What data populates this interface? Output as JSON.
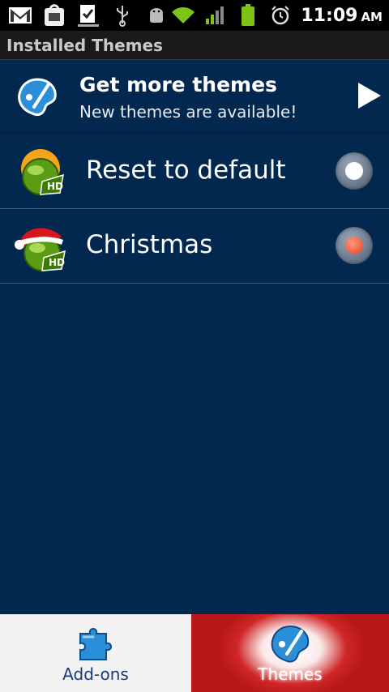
{
  "status_bar": {
    "time": "11:09",
    "ampm": "AM",
    "icons_left": [
      "gmail-icon",
      "market-icon",
      "task-icon",
      "usb-icon",
      "android-debug-icon"
    ],
    "icons_right": [
      "wifi-icon",
      "signal-icon",
      "battery-icon",
      "alarm-icon"
    ]
  },
  "title_bar": {
    "title": "Installed Themes"
  },
  "get_more": {
    "title": "Get more themes",
    "subtitle": "New themes are available!",
    "icon": "palette-icon",
    "arrow": "play-arrow-icon"
  },
  "themes": [
    {
      "label": "Reset to default",
      "icon": "hd-default-icon",
      "selected": false
    },
    {
      "label": "Christmas",
      "icon": "hd-christmas-icon",
      "selected": true
    }
  ],
  "tabs": [
    {
      "label": "Add-ons",
      "icon": "puzzle-icon",
      "active": false
    },
    {
      "label": "Themes",
      "icon": "palette-icon",
      "active": true
    }
  ],
  "colors": {
    "background": "#02284f",
    "title_bar": "#1a1a1a",
    "active_tab": "#b81818",
    "radio_selected": "#ef5a3c"
  }
}
